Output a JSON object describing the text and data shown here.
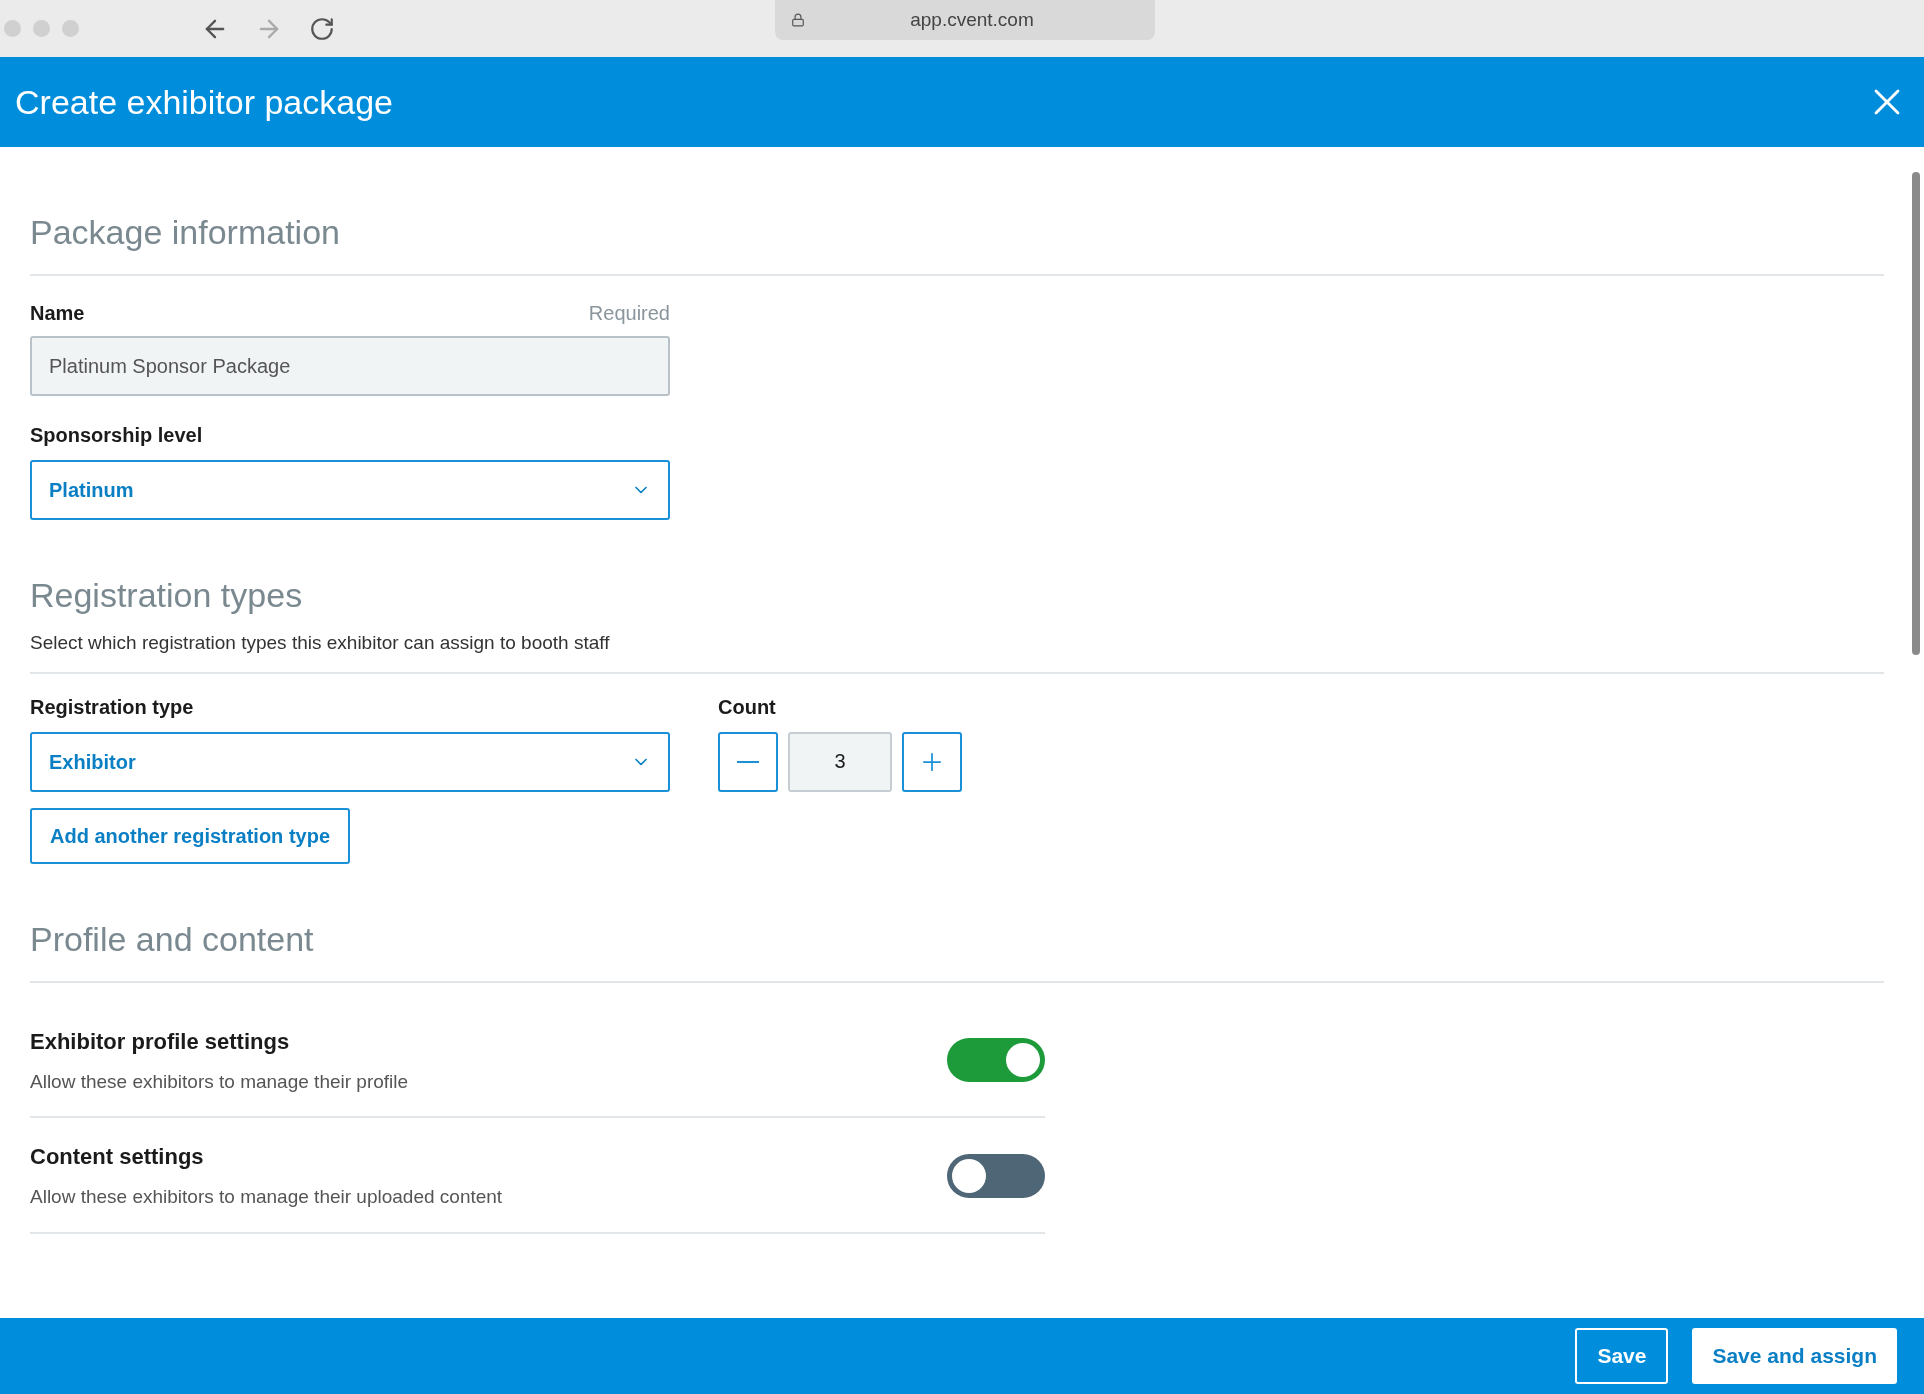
{
  "browser": {
    "url": "app.cvent.com"
  },
  "dialog": {
    "title": "Create exhibitor package"
  },
  "package_information": {
    "title": "Package information",
    "name": {
      "label": "Name",
      "required": "Required",
      "value": "Platinum Sponsor Package"
    },
    "sponsorship_level": {
      "label": "Sponsorship level",
      "value": "Platinum"
    }
  },
  "registration_types": {
    "title": "Registration types",
    "description": "Select which registration types this exhibitor can assign to booth staff",
    "type": {
      "label": "Registration type",
      "value": "Exhibitor"
    },
    "count": {
      "label": "Count",
      "value": "3"
    },
    "add_button": "Add another registration type"
  },
  "profile_and_content": {
    "title": "Profile and content",
    "settings": [
      {
        "title": "Exhibitor profile settings",
        "description": "Allow these exhibitors to manage their profile",
        "on": true
      },
      {
        "title": "Content settings",
        "description": "Allow these exhibitors to manage their uploaded content",
        "on": false
      }
    ]
  },
  "footer": {
    "buttons": [
      {
        "label": "Save",
        "kind": "secondary"
      },
      {
        "label": "Save and assign",
        "kind": "primary"
      }
    ]
  }
}
